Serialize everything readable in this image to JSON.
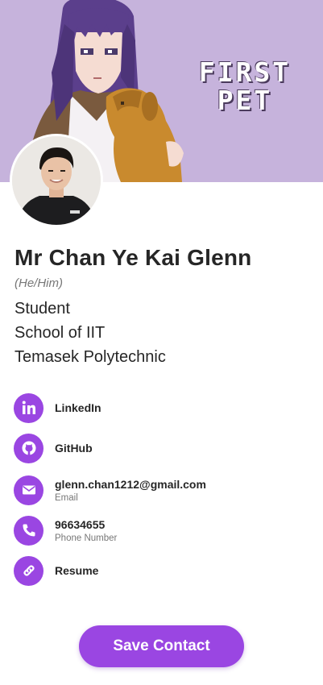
{
  "banner": {
    "title_line1": "FIRST",
    "title_line2": "PET"
  },
  "profile": {
    "name": "Mr Chan Ye Kai Glenn",
    "pronouns": "(He/Him)",
    "role": "Student",
    "department": "School of IIT",
    "organization": "Temasek Polytechnic"
  },
  "contacts": [
    {
      "icon": "linkedin-icon",
      "label": "LinkedIn",
      "sub": ""
    },
    {
      "icon": "github-icon",
      "label": "GitHub",
      "sub": ""
    },
    {
      "icon": "envelope-icon",
      "label": "glenn.chan1212@gmail.com",
      "sub": "Email"
    },
    {
      "icon": "phone-icon",
      "label": "96634655",
      "sub": "Phone Number"
    },
    {
      "icon": "link-icon",
      "label": "Resume",
      "sub": ""
    }
  ],
  "actions": {
    "save_label": "Save Contact"
  },
  "colors": {
    "accent": "#9a46e2",
    "banner_bg": "#c6b3dc"
  }
}
